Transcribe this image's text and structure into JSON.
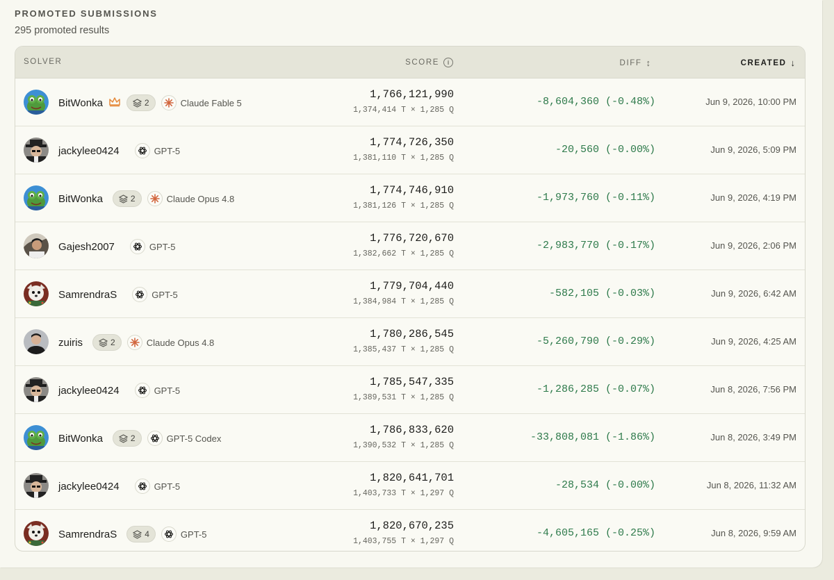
{
  "header": {
    "title": "PROMOTED SUBMISSIONS",
    "subtitle": "295 promoted results"
  },
  "columns": {
    "solver": "SOLVER",
    "score": "SCORE",
    "diff": "DIFF",
    "created": "CREATED"
  },
  "icons": {
    "info": "info-icon",
    "diff_sort": "sort-updown-icon",
    "created_sort": "arrow-down-icon",
    "crown": "crown-icon",
    "stack": "layers-icon",
    "openai": "openai-icon",
    "claude": "claude-sparkle-icon"
  },
  "colors": {
    "diff_positive": "#2e7a4b",
    "claude_accent": "#d2663e",
    "crown": "#e58a3c"
  },
  "rows": [
    {
      "solver": "BitWonka",
      "avatar": "frog",
      "crown": true,
      "stack": "2",
      "model": "Claude Fable 5",
      "model_type": "claude",
      "score": "1,766,121,990",
      "score_detail": "1,374,414 T × 1,285 Q",
      "diff": "-8,604,360 (-0.48%)",
      "created": "Jun 9, 2026, 10:00 PM"
    },
    {
      "solver": "jackylee0424",
      "avatar": "hat",
      "crown": false,
      "stack": "",
      "model": "GPT-5",
      "model_type": "openai",
      "score": "1,774,726,350",
      "score_detail": "1,381,110 T × 1,285 Q",
      "diff": "-20,560 (-0.00%)",
      "created": "Jun 9, 2026, 5:09 PM"
    },
    {
      "solver": "BitWonka",
      "avatar": "frog",
      "crown": false,
      "stack": "2",
      "model": "Claude Opus 4.8",
      "model_type": "claude",
      "score": "1,774,746,910",
      "score_detail": "1,381,126 T × 1,285 Q",
      "diff": "-1,973,760 (-0.11%)",
      "created": "Jun 9, 2026, 4:19 PM"
    },
    {
      "solver": "Gajesh2007",
      "avatar": "photo",
      "crown": false,
      "stack": "",
      "model": "GPT-5",
      "model_type": "openai",
      "score": "1,776,720,670",
      "score_detail": "1,382,662 T × 1,285 Q",
      "diff": "-2,983,770 (-0.17%)",
      "created": "Jun 9, 2026, 2:06 PM"
    },
    {
      "solver": "SamrendraS",
      "avatar": "pup",
      "crown": false,
      "stack": "",
      "model": "GPT-5",
      "model_type": "openai",
      "score": "1,779,704,440",
      "score_detail": "1,384,984 T × 1,285 Q",
      "diff": "-582,105 (-0.03%)",
      "created": "Jun 9, 2026, 6:42 AM"
    },
    {
      "solver": "zuiris",
      "avatar": "person",
      "crown": false,
      "stack": "2",
      "model": "Claude Opus 4.8",
      "model_type": "claude",
      "score": "1,780,286,545",
      "score_detail": "1,385,437 T × 1,285 Q",
      "diff": "-5,260,790 (-0.29%)",
      "created": "Jun 9, 2026, 4:25 AM"
    },
    {
      "solver": "jackylee0424",
      "avatar": "hat",
      "crown": false,
      "stack": "",
      "model": "GPT-5",
      "model_type": "openai",
      "score": "1,785,547,335",
      "score_detail": "1,389,531 T × 1,285 Q",
      "diff": "-1,286,285 (-0.07%)",
      "created": "Jun 8, 2026, 7:56 PM"
    },
    {
      "solver": "BitWonka",
      "avatar": "frog",
      "crown": false,
      "stack": "2",
      "model": "GPT-5 Codex",
      "model_type": "openai",
      "score": "1,786,833,620",
      "score_detail": "1,390,532 T × 1,285 Q",
      "diff": "-33,808,081 (-1.86%)",
      "created": "Jun 8, 2026, 3:49 PM"
    },
    {
      "solver": "jackylee0424",
      "avatar": "hat",
      "crown": false,
      "stack": "",
      "model": "GPT-5",
      "model_type": "openai",
      "score": "1,820,641,701",
      "score_detail": "1,403,733 T × 1,297 Q",
      "diff": "-28,534 (-0.00%)",
      "created": "Jun 8, 2026, 11:32 AM"
    },
    {
      "solver": "SamrendraS",
      "avatar": "pup",
      "crown": false,
      "stack": "4",
      "model": "GPT-5",
      "model_type": "openai",
      "score": "1,820,670,235",
      "score_detail": "1,403,755 T × 1,297 Q",
      "diff": "-4,605,165 (-0.25%)",
      "created": "Jun 8, 2026, 9:59 AM"
    }
  ]
}
